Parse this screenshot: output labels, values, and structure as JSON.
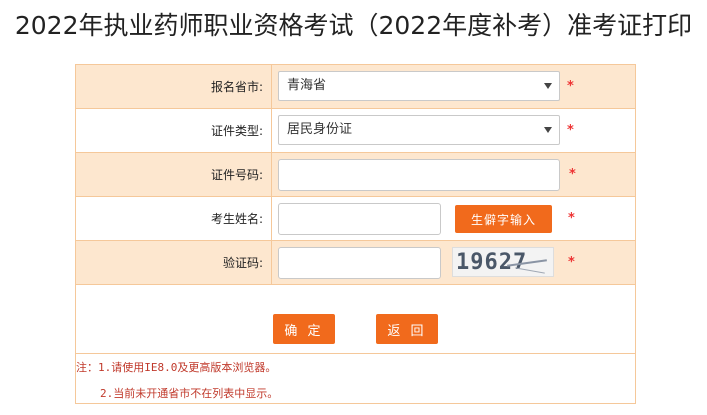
{
  "page": {
    "title": "2022年执业药师职业资格考试（2022年度补考）准考证打印"
  },
  "form": {
    "province": {
      "label": "报名省市:",
      "value": "青海省"
    },
    "id_type": {
      "label": "证件类型:",
      "value": "居民身份证"
    },
    "id_number": {
      "label": "证件号码:",
      "value": ""
    },
    "name": {
      "label": "考生姓名:",
      "value": "",
      "rare_char_button": "生僻字输入"
    },
    "captcha": {
      "label": "验证码:",
      "value": "",
      "image_text": "19627"
    },
    "required_mark": "*"
  },
  "actions": {
    "confirm": "确 定",
    "back": "返 回"
  },
  "notes": {
    "line1": "注：1.请使用IE8.0及更高版本浏览器。",
    "line2": "2.当前未开通省市不在列表中显示。"
  },
  "colors": {
    "accent": "#f16a1c",
    "row_alt": "#fde7cf",
    "border": "#f5c89a",
    "required": "#e33333"
  }
}
